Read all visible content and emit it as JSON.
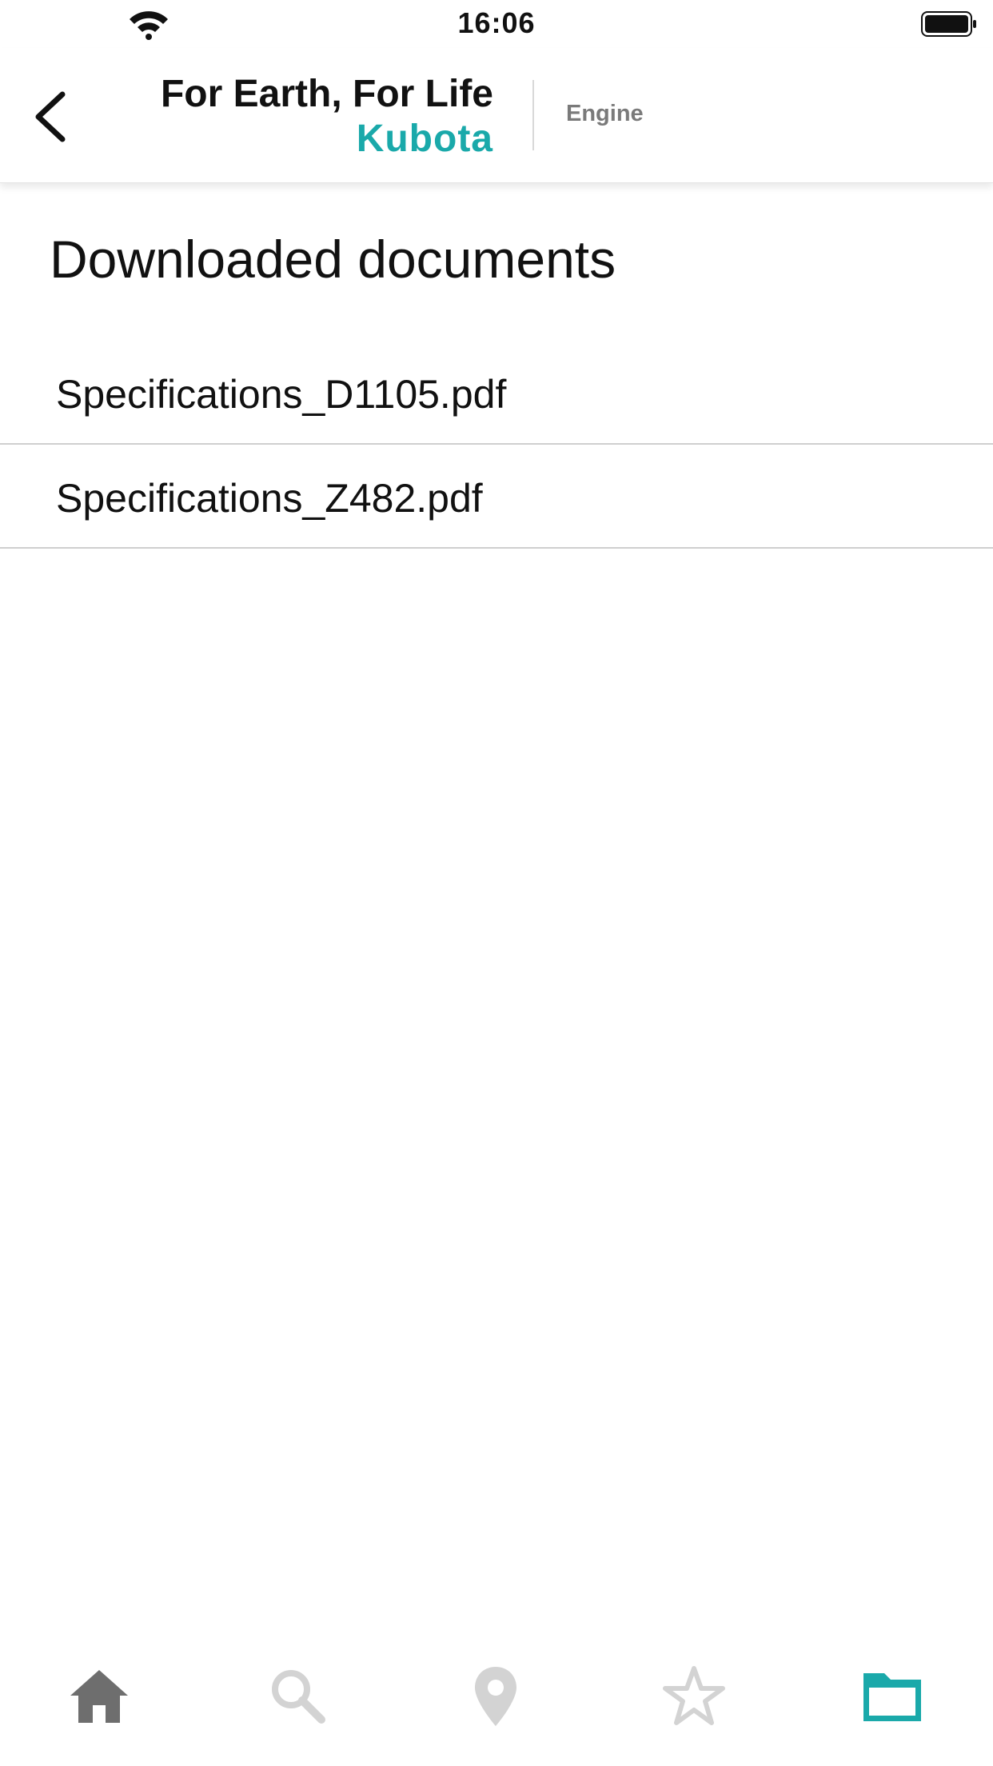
{
  "status_bar": {
    "time": "16:06"
  },
  "header": {
    "logo_line1": "For Earth, For Life",
    "logo_line2": "Kubota",
    "section": "Engine"
  },
  "page": {
    "title": "Downloaded documents"
  },
  "documents": [
    {
      "name": "Specifications_D1105.pdf"
    },
    {
      "name": "Specifications_Z482.pdf"
    }
  ],
  "tabbar": {
    "tabs": [
      {
        "icon": "home-icon",
        "active": false
      },
      {
        "icon": "search-icon",
        "active": false
      },
      {
        "icon": "location-pin-icon",
        "active": false
      },
      {
        "icon": "star-icon",
        "active": false
      },
      {
        "icon": "folder-icon",
        "active": true
      }
    ]
  },
  "colors": {
    "accent": "#1aa9aa",
    "inactive_icon": "#d3d3d3",
    "home_icon": "#6e6e6e",
    "divider": "#cfcfcf"
  }
}
